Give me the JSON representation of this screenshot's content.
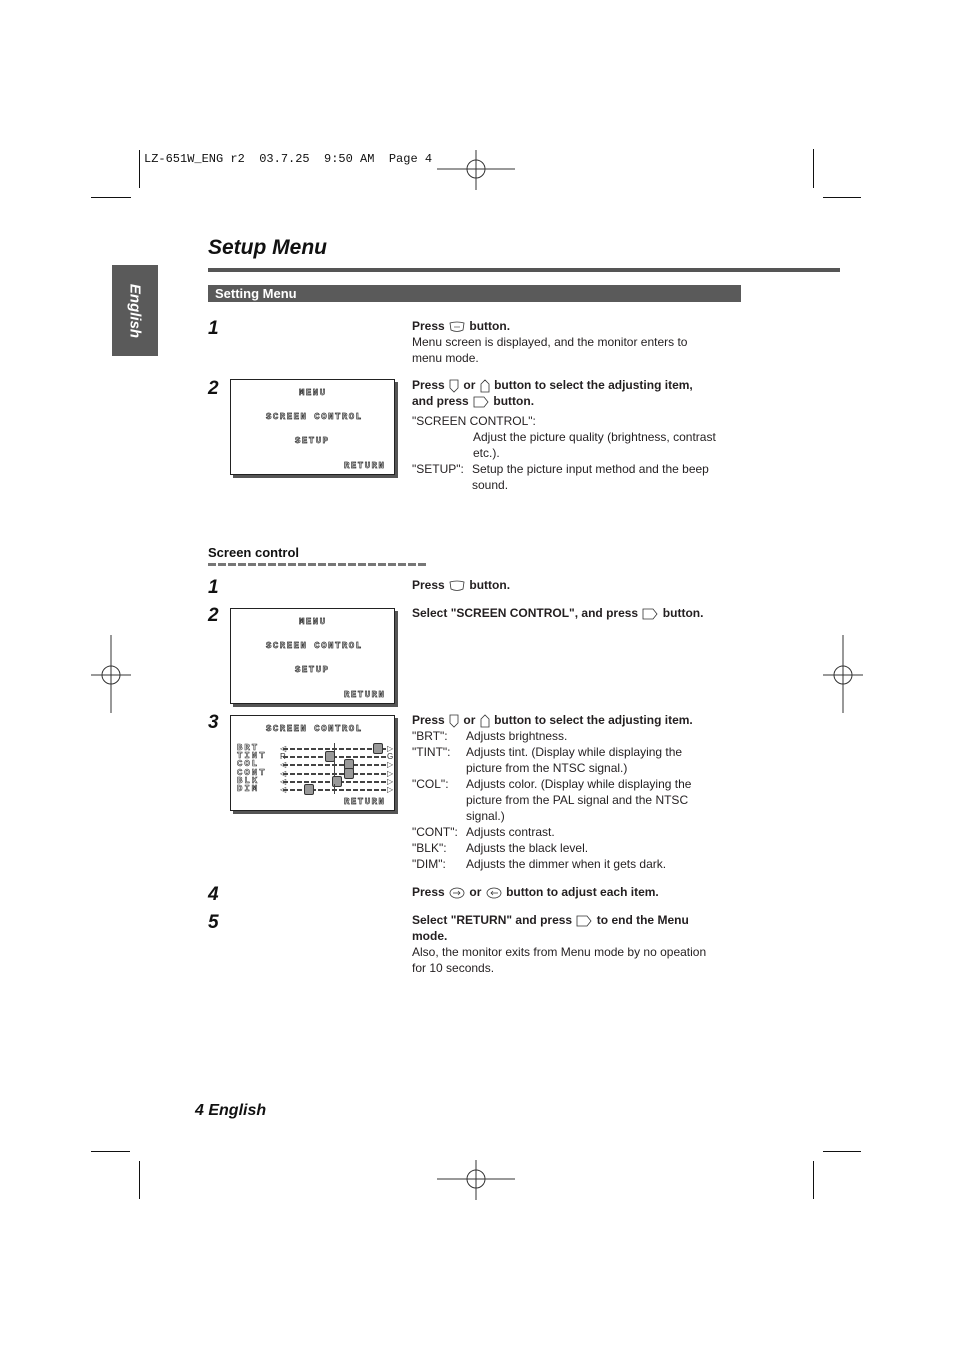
{
  "slug": "LZ-651W_ENG r2  03.7.25  9:50 AM  Page 4",
  "side_tab": "English",
  "title": "Setup Menu",
  "section": "Setting Menu",
  "setting_menu": {
    "steps": [
      {
        "num": "1",
        "bold_pre": "Press",
        "icon": "menu-button-icon",
        "bold_post": "button.",
        "text": [
          "Menu screen is displayed, and the monitor enters to",
          "menu mode."
        ]
      },
      {
        "num": "2",
        "bold_line1_pre": "Press",
        "icon1": "down-button-icon",
        "or": "or",
        "icon2": "up-button-icon",
        "bold_line1_post": "button to select the adjusting item,",
        "bold_line2_pre": "and press",
        "icon3": "enter-button-icon",
        "bold_line2_post": "button.",
        "defs": [
          {
            "term": "\"SCREEN CONTROL\":",
            "desc": [
              "Adjust the picture quality (brightness, contrast",
              "etc.)."
            ]
          },
          {
            "term": "\"SETUP\":",
            "desc": [
              "Setup the picture input method and the beep",
              "sound."
            ]
          }
        ]
      }
    ],
    "osd": {
      "title": "MENU",
      "items": [
        "SCREEN CONTROL",
        "SETUP"
      ],
      "return": "RETURN"
    }
  },
  "screen_control": {
    "heading": "Screen control",
    "steps": [
      {
        "num": "1",
        "pre": "Press",
        "post": "button."
      },
      {
        "num": "2",
        "pre": "Select \"SCREEN CONTROL\", and press",
        "post": "button."
      },
      {
        "num": "3",
        "pre": "Press",
        "or": "or",
        "post": "button to select the adjusting item.",
        "defs": [
          {
            "term": "\"BRT\":",
            "desc": [
              "Adjusts brightness."
            ]
          },
          {
            "term": "\"TINT\":",
            "desc": [
              "Adjusts tint. (Display while displaying the",
              "picture from the NTSC signal.)"
            ]
          },
          {
            "term": "\"COL\":",
            "desc": [
              "Adjusts color. (Display while displaying the",
              "picture from the PAL signal and the NTSC",
              "signal.)"
            ]
          },
          {
            "term": "\"CONT\":",
            "desc": [
              "Adjusts contrast."
            ]
          },
          {
            "term": "\"BLK\":",
            "desc": [
              "Adjusts the black level."
            ]
          },
          {
            "term": "\"DIM\":",
            "desc": [
              "Adjusts the dimmer when it gets dark."
            ]
          }
        ]
      },
      {
        "num": "4",
        "pre": "Press",
        "or": "or",
        "post": "button to adjust each item."
      },
      {
        "num": "5",
        "pre": "Select \"RETURN\" and press",
        "post": "to end the Menu",
        "post2": "mode.",
        "text": [
          "Also, the monitor exits from Menu mode by no opeation",
          "for 10 seconds."
        ]
      }
    ],
    "osd_menu": {
      "title": "MENU",
      "items": [
        "SCREEN CONTROL",
        "SETUP"
      ],
      "return": "RETURN"
    },
    "osd_control": {
      "title": "SCREEN CONTROL",
      "return": "RETURN",
      "sliders": [
        {
          "label": "BRT",
          "left": "◁",
          "right": "▷",
          "level": 0.95
        },
        {
          "label": "TINT",
          "left": "R",
          "right": "G",
          "level": 0.42
        },
        {
          "label": "COL",
          "left": "◁",
          "right": "▷",
          "level": 0.63
        },
        {
          "label": "CONT",
          "left": "◁",
          "right": "▷",
          "level": 0.63
        },
        {
          "label": "BLK",
          "left": "◁",
          "right": "▷",
          "level": 0.5
        },
        {
          "label": "DIM",
          "left": "◁",
          "right": "▷",
          "level": 0.2
        }
      ]
    }
  },
  "footer": "4 English"
}
